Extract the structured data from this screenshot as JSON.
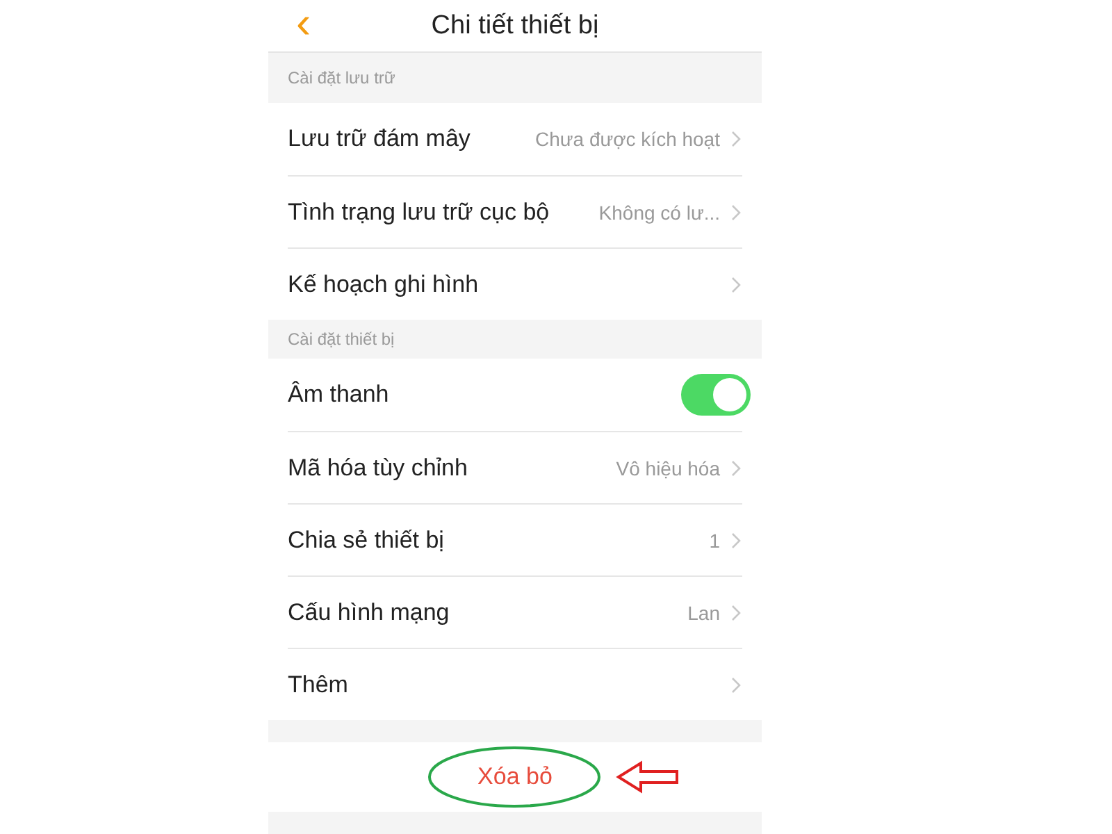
{
  "header": {
    "back": "‹",
    "title": "Chi tiết thiết bị"
  },
  "sections": [
    {
      "title": "Cài đặt lưu trữ",
      "rows": [
        {
          "kind": "link",
          "label": "Lưu trữ đám mây",
          "value": "Chưa được kích hoạt"
        },
        {
          "kind": "link",
          "label": "Tình trạng lưu trữ cục bộ",
          "value": "Không có lư..."
        },
        {
          "kind": "link",
          "label": "Kế hoạch ghi hình"
        }
      ]
    },
    {
      "title": "Cài đặt thiết bị",
      "rows": [
        {
          "kind": "toggle",
          "label": "Âm thanh",
          "on": true
        },
        {
          "kind": "link",
          "label": "Mã hóa tùy chỉnh",
          "value": "Vô hiệu hóa"
        },
        {
          "kind": "link",
          "label": "Chia sẻ thiết bị",
          "value": "1"
        },
        {
          "kind": "link",
          "label": "Cấu hình mạng",
          "value": "Lan"
        },
        {
          "kind": "link",
          "label": "Thêm"
        }
      ]
    }
  ],
  "delete_button": {
    "label": "Xóa bỏ"
  }
}
